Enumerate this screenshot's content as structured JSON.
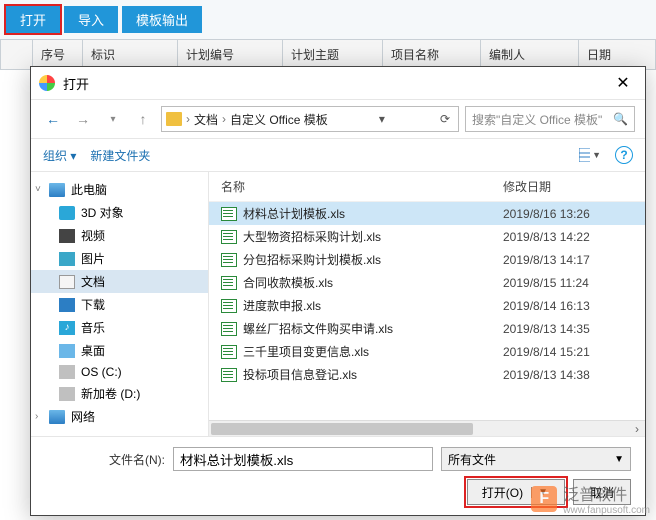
{
  "toolbar": {
    "open": "打开",
    "import": "导入",
    "export": "模板输出"
  },
  "grid": {
    "seq": "序号",
    "label": "标识",
    "planNo": "计划编号",
    "planSubject": "计划主题",
    "projectName": "项目名称",
    "author": "编制人",
    "date": "日期"
  },
  "dialog": {
    "title": "打开",
    "close": "✕",
    "nav": {
      "back": "←",
      "forward": "→",
      "up": "↑",
      "refresh": "⟳",
      "drop": "▾"
    },
    "crumbs": {
      "folder": "文档",
      "sub": "自定义 Office 模板",
      "sep": "›"
    },
    "search": {
      "placeholder": "搜索\"自定义 Office 模板\"",
      "icon": "🔍"
    },
    "tools": {
      "organize": "组织 ▾",
      "newFolder": "新建文件夹",
      "help": "?"
    },
    "tree": [
      {
        "label": "此电脑",
        "cls": "ic-pc",
        "top": true,
        "exp": "˅"
      },
      {
        "label": "3D 对象",
        "cls": "ic-3d"
      },
      {
        "label": "视频",
        "cls": "ic-vid"
      },
      {
        "label": "图片",
        "cls": "ic-pic"
      },
      {
        "label": "文档",
        "cls": "ic-doc",
        "sel": true
      },
      {
        "label": "下载",
        "cls": "ic-dl"
      },
      {
        "label": "音乐",
        "cls": "ic-mus"
      },
      {
        "label": "桌面",
        "cls": "ic-desk"
      },
      {
        "label": "OS (C:)",
        "cls": "ic-os"
      },
      {
        "label": "新加卷 (D:)",
        "cls": "ic-dv"
      },
      {
        "label": "网络",
        "cls": "ic-net",
        "top": true,
        "exp": "›"
      }
    ],
    "listHead": {
      "name": "名称",
      "date": "修改日期"
    },
    "files": [
      {
        "name": "材料总计划模板.xls",
        "date": "2019/8/16 13:26",
        "sel": true
      },
      {
        "name": "大型物资招标采购计划.xls",
        "date": "2019/8/13 14:22"
      },
      {
        "name": "分包招标采购计划模板.xls",
        "date": "2019/8/13 14:17"
      },
      {
        "name": "合同收款模板.xls",
        "date": "2019/8/15 11:24"
      },
      {
        "name": "进度款申报.xls",
        "date": "2019/8/14 16:13"
      },
      {
        "name": "螺丝厂招标文件购买申请.xls",
        "date": "2019/8/13 14:35"
      },
      {
        "name": "三千里项目变更信息.xls",
        "date": "2019/8/14 15:21"
      },
      {
        "name": "投标项目信息登记.xls",
        "date": "2019/8/13 14:38"
      }
    ],
    "foot": {
      "fileLabel": "文件名(N):",
      "fileValue": "材料总计划模板.xls",
      "filter": "所有文件",
      "open": "打开(O)",
      "split": "▼",
      "cancel": "取消"
    }
  },
  "watermark": {
    "brand": "泛普软件",
    "url": "www.fanpusoft.com",
    "logo": "F"
  }
}
